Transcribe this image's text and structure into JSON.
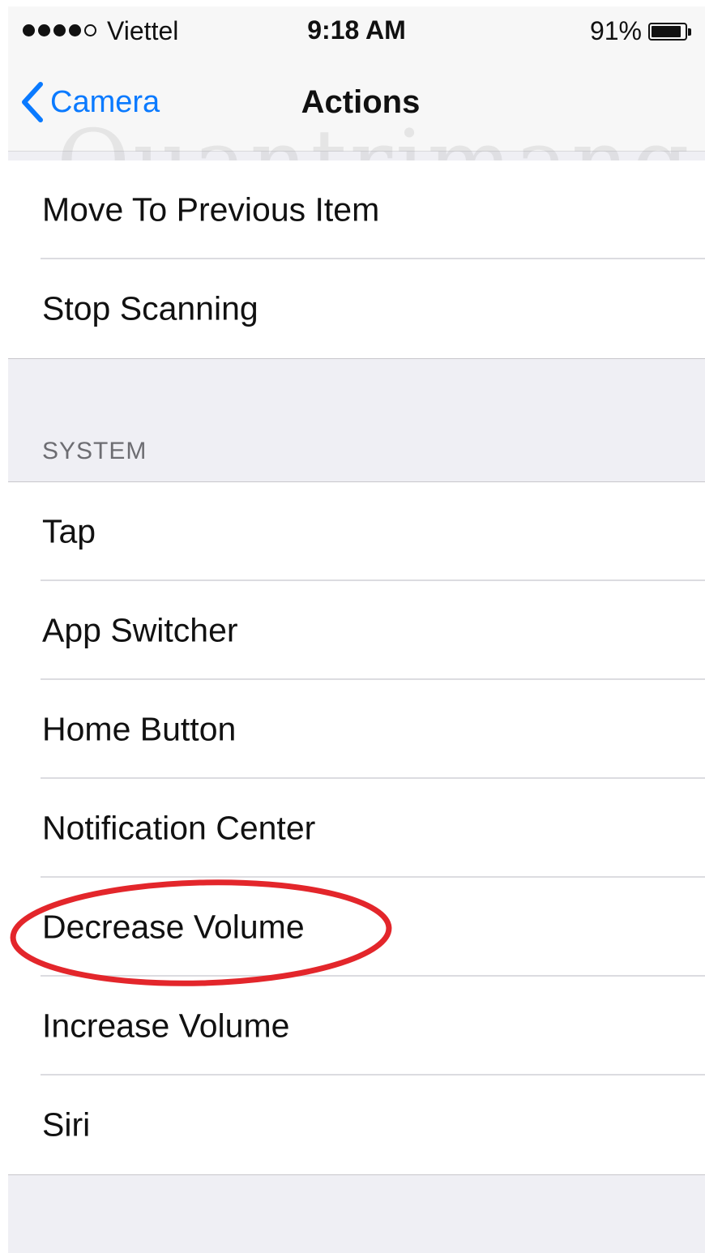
{
  "status_bar": {
    "carrier": "Viettel",
    "time": "9:18 AM",
    "battery_percent": "91%",
    "signal_bars": 4,
    "signal_max": 5,
    "battery_level": 0.91
  },
  "nav": {
    "back_label": "Camera",
    "title": "Actions"
  },
  "watermark": {
    "text": "Quantrimang"
  },
  "actions_list": [
    {
      "label": "Move To Previous Item"
    },
    {
      "label": "Stop Scanning"
    }
  ],
  "system_section": {
    "header": "SYSTEM",
    "items": [
      {
        "label": "Tap"
      },
      {
        "label": "App Switcher"
      },
      {
        "label": "Home Button"
      },
      {
        "label": "Notification Center"
      },
      {
        "label": "Decrease Volume",
        "highlighted": true
      },
      {
        "label": "Increase Volume"
      },
      {
        "label": "Siri"
      }
    ]
  },
  "colors": {
    "accent": "#0a7aff",
    "highlight": "#e3262b",
    "background": "#efeff4"
  }
}
